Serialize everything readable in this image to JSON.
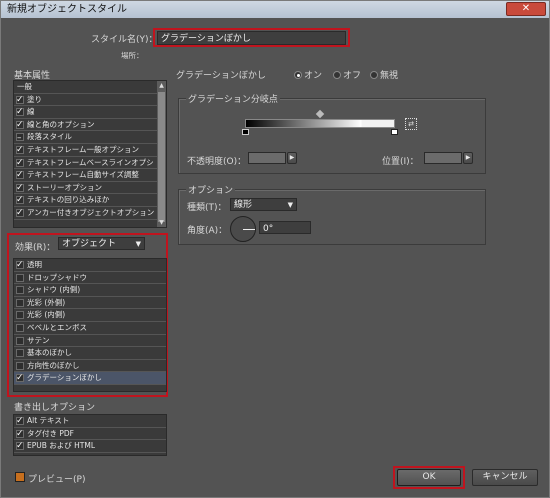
{
  "window": {
    "title": "新規オブジェクトスタイル",
    "close_glyph": "✕"
  },
  "style_name": {
    "label": "スタイル名(Y)：",
    "value": "グラデーションぼかし",
    "location_label": "場所："
  },
  "basic_attributes": {
    "heading": "基本属性",
    "items": [
      {
        "label": "一般",
        "state": "none"
      },
      {
        "label": "塗り",
        "state": "on"
      },
      {
        "label": "線",
        "state": "on"
      },
      {
        "label": "線と角のオプション",
        "state": "on"
      },
      {
        "label": "段落スタイル",
        "state": "dash"
      },
      {
        "label": "テキストフレーム一般オプション",
        "state": "on"
      },
      {
        "label": "テキストフレームベースラインオプシ",
        "state": "on"
      },
      {
        "label": "テキストフレーム自動サイズ調整",
        "state": "on"
      },
      {
        "label": "ストーリーオプション",
        "state": "on"
      },
      {
        "label": "テキストの回り込みほか",
        "state": "on"
      },
      {
        "label": "アンカー付きオブジェクトオプション",
        "state": "on"
      }
    ]
  },
  "effects": {
    "label": "効果(R)：",
    "target": "オブジェクト",
    "items": [
      {
        "label": "透明",
        "state": "on",
        "selected": false
      },
      {
        "label": "ドロップシャドウ",
        "state": "off",
        "selected": false
      },
      {
        "label": "シャドウ (内側)",
        "state": "off",
        "selected": false
      },
      {
        "label": "光彩 (外側)",
        "state": "off",
        "selected": false
      },
      {
        "label": "光彩 (内側)",
        "state": "off",
        "selected": false
      },
      {
        "label": "ベベルとエンボス",
        "state": "off",
        "selected": false
      },
      {
        "label": "サテン",
        "state": "off",
        "selected": false
      },
      {
        "label": "基本のぼかし",
        "state": "off",
        "selected": false
      },
      {
        "label": "方向性のぼかし",
        "state": "off",
        "selected": false
      },
      {
        "label": "グラデーションぼかし",
        "state": "on",
        "selected": true
      }
    ]
  },
  "export_options": {
    "heading": "書き出しオプション",
    "items": [
      {
        "label": "Alt テキスト",
        "state": "on"
      },
      {
        "label": "タグ付き PDF",
        "state": "on"
      },
      {
        "label": "EPUB および HTML",
        "state": "on"
      }
    ]
  },
  "gradient_feather": {
    "heading": "グラデーションぼかし",
    "radio_on": "オン",
    "radio_off": "オフ",
    "radio_ignore": "無視",
    "stops_group": "グラデーション分岐点",
    "opacity_label": "不透明度(O)：",
    "position_label": "位置(I)：",
    "options_group": "オプション",
    "type_label": "種類(T)：",
    "type_value": "線形",
    "angle_label": "角度(A)：",
    "angle_value": "0°"
  },
  "footer": {
    "preview_label": "プレビュー(P)",
    "ok_label": "OK",
    "cancel_label": "キャンセル"
  },
  "colors": {
    "highlight_red": "#c0141e",
    "panel_bg": "#535353",
    "selection_bg": "#4b5568"
  }
}
